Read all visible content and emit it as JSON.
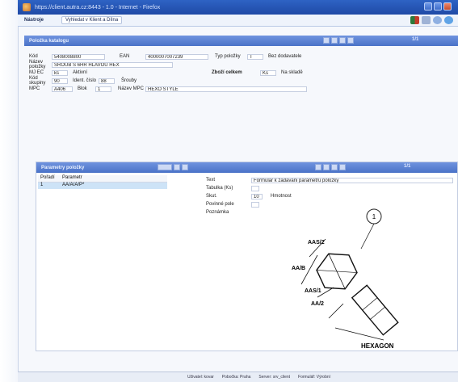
{
  "window": {
    "title": "https://client.autra.cz:8443 - 1.0 - Internet - Firefox",
    "colors": {
      "titlebar": "#2e63c4",
      "panel_header": "#4a72c7",
      "selection": "#cde3f7"
    }
  },
  "menu": {
    "items": [
      "Nástroje",
      "Kategorie"
    ],
    "sub_label": "Vyhledat v Klient a Dílna"
  },
  "toolbar_icons": [
    "flag-icon",
    "back-icon",
    "search-icon",
    "globe-icon"
  ],
  "top_panel": {
    "title": "Položka katalogu",
    "page": "1/1"
  },
  "top_form": {
    "row1": {
      "l1": "Kód",
      "v1": "5408008800",
      "l2": "EAN",
      "v2": "4000007007239",
      "l3": "Typ položky",
      "v3": "T",
      "v4": "Bez dodavatele"
    },
    "row2": {
      "l1": "Název položky",
      "v1": "ŠROUB S 6HR HLAVOU HEX"
    },
    "row3": {
      "l1": "MJ EC",
      "v1": "ks",
      "v2": "Aktivní",
      "l3": "Zboží celkem",
      "v3": "Ks",
      "v4": "Na skladě"
    },
    "row4": {
      "l1": "Kód skupiny",
      "v1": "90",
      "l2": "Ident. číslo",
      "v2": "88",
      "v3": "Šrouby"
    },
    "row5": {
      "l1": "MPC",
      "v1": "A406",
      "l2": "Blok",
      "v2": "1",
      "l3": "Název MPC",
      "v3": "HEXO STYLE"
    }
  },
  "lower_panel": {
    "title": "Parametry položky",
    "page": "1/1",
    "list_headers": [
      "Pořadí",
      "Parametr"
    ],
    "list_rows": [
      {
        "num": "1",
        "name": "AA/A/A/P*"
      }
    ],
    "detail": [
      {
        "label": "Text",
        "value": "Formular k zadavani parametru polozky"
      },
      {
        "label": "Tabulka (Ks)",
        "value": ""
      },
      {
        "label": "Skut.",
        "value": "10",
        "extra": "Hmotnost"
      },
      {
        "label": "Povinné pole",
        "value": ""
      },
      {
        "label": "Poznámka",
        "value": ""
      }
    ]
  },
  "diagram": {
    "circle_number": "1",
    "labels": [
      "AAS/2",
      "AA/B",
      "AAS/1",
      "AA/2",
      "HEXAGON"
    ]
  },
  "status_bar": {
    "segments": [
      "Uživatel: kovar",
      "Pobočka: Praha",
      "Server: srv_client",
      "Formulář: Výrobní"
    ]
  }
}
